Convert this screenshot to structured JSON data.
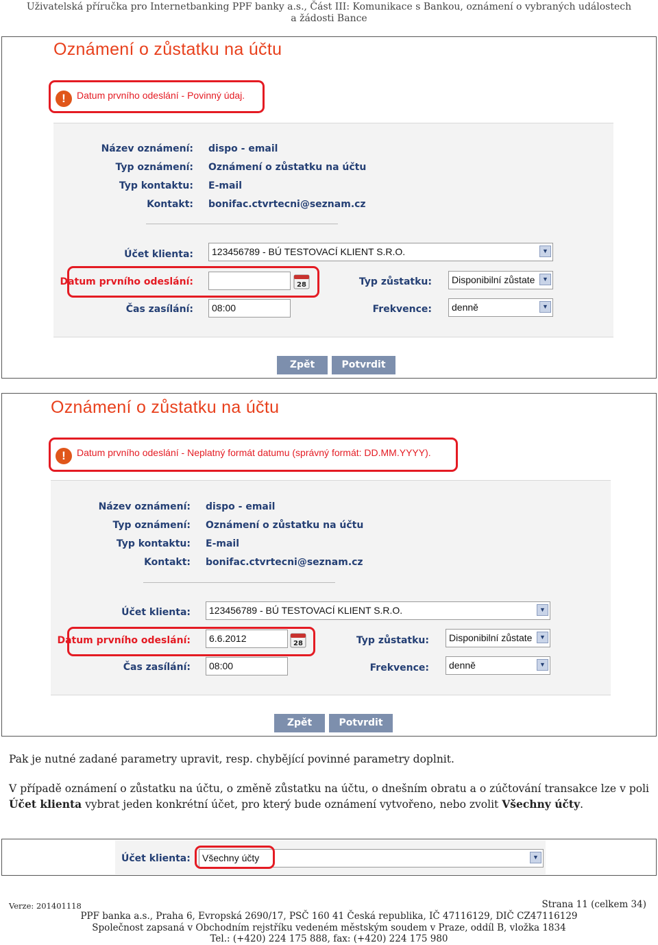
{
  "header": {
    "line1": "Uživatelská příručka pro Internetbanking PPF banky a.s., Část III: Komunikace s Bankou, oznámení o vybraných událostech",
    "line2": "a žádosti Bance"
  },
  "screens": [
    {
      "title": "Oznámení o zůstatku na účtu",
      "error": "Datum prvního odeslání - Povinný údaj.",
      "info": {
        "name_label": "Název oznámení:",
        "name_value": "dispo - email",
        "type_label": "Typ oznámení:",
        "type_value": "Oznámení o zůstatku na účtu",
        "contact_type_label": "Typ kontaktu:",
        "contact_type_value": "E-mail",
        "contact_label": "Kontakt:",
        "contact_value": "bonifac.ctvrtecni@seznam.cz"
      },
      "form": {
        "account_label": "Účet klienta:",
        "account_value": "123456789 - BÚ TESTOVACÍ KLIENT S.R.O.",
        "date_label": "Datum prvního odeslání:",
        "date_value": "",
        "balance_type_label": "Typ zůstatku:",
        "balance_type_value": "Disponibilní zůstate",
        "time_label": "Čas zasílání:",
        "time_value": "08:00",
        "frequency_label": "Frekvence:",
        "frequency_value": "denně",
        "calendar_day": "28"
      },
      "buttons": {
        "back": "Zpět",
        "confirm": "Potvrdit"
      }
    },
    {
      "title": "Oznámení o zůstatku na účtu",
      "error": "Datum prvního odeslání - Neplatný formát datumu (správný formát: DD.MM.YYYY).",
      "info": {
        "name_label": "Název oznámení:",
        "name_value": "dispo - email",
        "type_label": "Typ oznámení:",
        "type_value": "Oznámení o zůstatku na účtu",
        "contact_type_label": "Typ kontaktu:",
        "contact_type_value": "E-mail",
        "contact_label": "Kontakt:",
        "contact_value": "bonifac.ctvrtecni@seznam.cz"
      },
      "form": {
        "account_label": "Účet klienta:",
        "account_value": "123456789 - BÚ TESTOVACÍ KLIENT S.R.O.",
        "date_label": "Datum prvního odeslání:",
        "date_value": "6.6.2012",
        "balance_type_label": "Typ zůstatku:",
        "balance_type_value": "Disponibilní zůstate",
        "time_label": "Čas zasílání:",
        "time_value": "08:00",
        "frequency_label": "Frekvence:",
        "frequency_value": "denně",
        "calendar_day": "28"
      },
      "buttons": {
        "back": "Zpět",
        "confirm": "Potvrdit"
      }
    }
  ],
  "text": {
    "para1": "Pak je nutné zadané parametry upravit, resp. chybějící povinné parametry doplnit.",
    "para2_a": "V případě oznámení o zůstatku na účtu, o změně zůstatku na účtu, o dnešním obratu a o zúčtování transakce lze v poli ",
    "para2_b": "Účet klienta",
    "para2_c": " vybrat jeden konkrétní účet, pro který bude oznámení vytvořeno, nebo zvolit ",
    "para2_d": "Všechny účty",
    "para2_e": "."
  },
  "mini": {
    "account_label": "Účet klienta:",
    "account_value": "Všechny účty"
  },
  "footer": {
    "version": "Verze: 201401118",
    "page": "Strana 11 (celkem 34)",
    "line1": "PPF banka a.s., Praha 6, Evropská 2690/17, PSČ 160 41 Česká republika, IČ 47116129, DIČ CZ47116129",
    "line2": "Společnost zapsaná v Obchodním rejstříku vedeném městským soudem v Praze, oddíl B, vložka 1834",
    "line3": "Tel.: (+420) 224 175 888, fax: (+420) 224 175 980"
  }
}
